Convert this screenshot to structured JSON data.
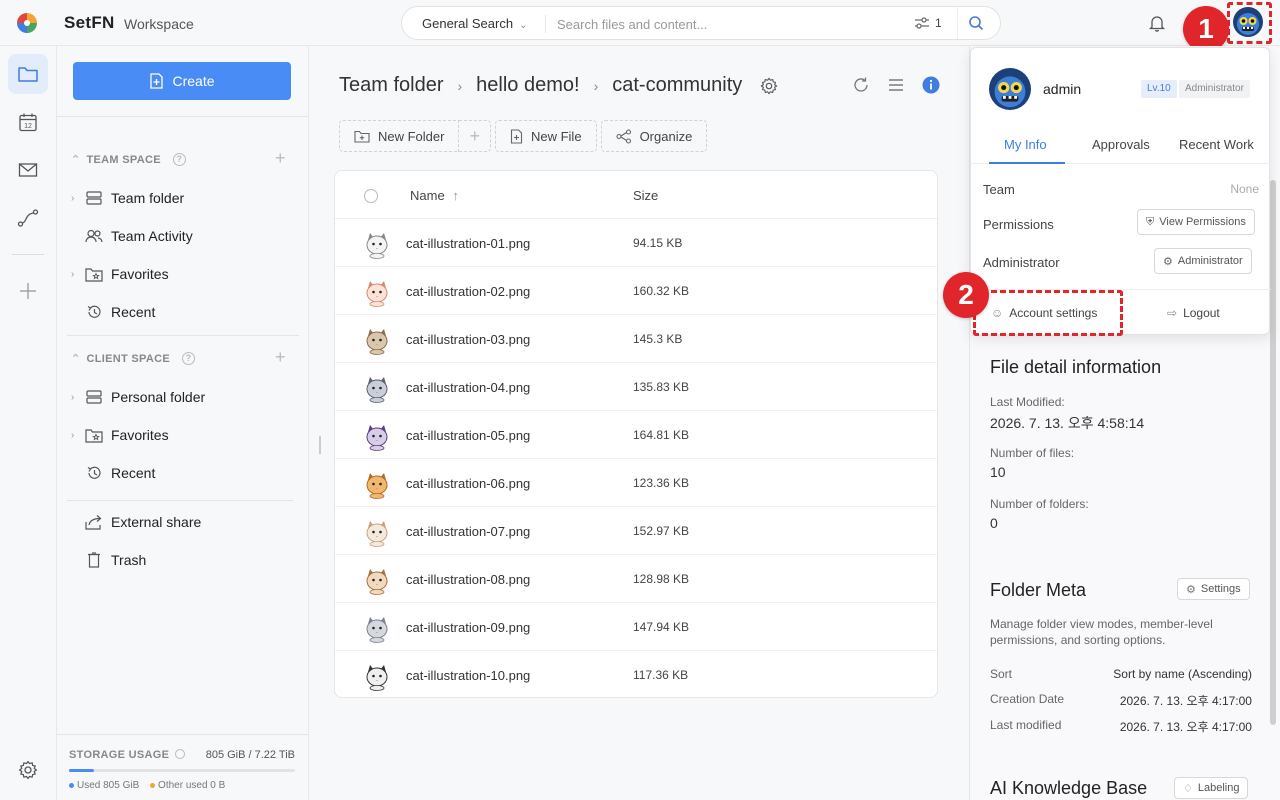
{
  "app": {
    "brand": "SetFN",
    "workspace": "Workspace"
  },
  "search": {
    "scope": "General Search",
    "placeholder": "Search files and content...",
    "filter_count": "1"
  },
  "markers": {
    "one": "1",
    "two": "2"
  },
  "sidebar": {
    "create_label": "Create",
    "team_space": {
      "heading": "TEAM SPACE",
      "items": [
        "Team folder",
        "Team Activity",
        "Favorites",
        "Recent"
      ]
    },
    "client_space": {
      "heading": "CLIENT SPACE",
      "items": [
        "Personal folder",
        "Favorites",
        "Recent"
      ]
    },
    "extra_items": [
      "External share",
      "Trash"
    ],
    "storage": {
      "title": "STORAGE USAGE",
      "value": "805 GiB / 7.22 TiB",
      "used_fraction": 0.109,
      "used_label": "Used 805 GiB",
      "other_label": "Other used 0 B"
    }
  },
  "breadcrumb": [
    "Team folder",
    "hello demo!",
    "cat-community"
  ],
  "toolbar": {
    "new_folder": "New Folder",
    "new_file": "New File",
    "organize": "Organize"
  },
  "table": {
    "col_name": "Name",
    "col_size": "Size",
    "rows": [
      {
        "name": "cat-illustration-01.png",
        "size": "94.15 KB"
      },
      {
        "name": "cat-illustration-02.png",
        "size": "160.32 KB"
      },
      {
        "name": "cat-illustration-03.png",
        "size": "145.3 KB"
      },
      {
        "name": "cat-illustration-04.png",
        "size": "135.83 KB"
      },
      {
        "name": "cat-illustration-05.png",
        "size": "164.81 KB"
      },
      {
        "name": "cat-illustration-06.png",
        "size": "123.36 KB"
      },
      {
        "name": "cat-illustration-07.png",
        "size": "152.97 KB"
      },
      {
        "name": "cat-illustration-08.png",
        "size": "128.98 KB"
      },
      {
        "name": "cat-illustration-09.png",
        "size": "147.94 KB"
      },
      {
        "name": "cat-illustration-10.png",
        "size": "117.36 KB"
      }
    ]
  },
  "profile": {
    "name": "admin",
    "level": "Lv.10",
    "role": "Administrator",
    "tabs": [
      "My Info",
      "Approvals",
      "Recent Work"
    ],
    "team_label": "Team",
    "team_value": "None",
    "permissions_label": "Permissions",
    "view_permissions": "View Permissions",
    "administrator_label": "Administrator",
    "administrator_button": "Administrator",
    "account_settings": "Account settings",
    "logout": "Logout"
  },
  "detail": {
    "title": "File detail information",
    "last_modified_label": "Last Modified:",
    "last_modified_value": "2026. 7. 13. 오후 4:58:14",
    "files_label": "Number of files:",
    "files_value": "10",
    "folders_label": "Number of folders:",
    "folders_value": "0",
    "meta_title": "Folder Meta",
    "meta_settings": "Settings",
    "meta_desc": "Manage folder view modes, member-level permissions, and sorting options.",
    "sort_label": "Sort",
    "sort_value": "Sort by name (Ascending)",
    "creation_label": "Creation Date",
    "creation_value": "2026. 7. 13. 오후 4:17:00",
    "modified_label": "Last modified",
    "modified_value": "2026. 7. 13. 오후 4:17:00",
    "ai_title": "AI Knowledge Base",
    "ai_button": "Labeling"
  }
}
